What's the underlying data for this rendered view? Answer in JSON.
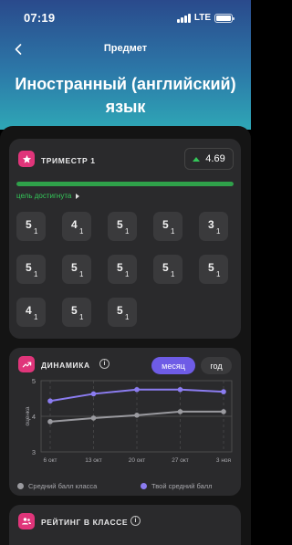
{
  "status_bar": {
    "time": "07:19",
    "network": "LTE"
  },
  "nav": {
    "title": "Предмет"
  },
  "subject": {
    "name": "Иностранный (английский) язык"
  },
  "term": {
    "title": "ТРИМЕСТР 1",
    "average": "4.69",
    "goal_text": "цель достигнута",
    "progress": 1.0,
    "grades": [
      {
        "value": "5",
        "weight": "1"
      },
      {
        "value": "4",
        "weight": "1"
      },
      {
        "value": "5",
        "weight": "1"
      },
      {
        "value": "5",
        "weight": "1"
      },
      {
        "value": "3",
        "weight": "1"
      },
      {
        "value": "5",
        "weight": "1"
      },
      {
        "value": "5",
        "weight": "1"
      },
      {
        "value": "5",
        "weight": "1"
      },
      {
        "value": "5",
        "weight": "1"
      },
      {
        "value": "5",
        "weight": "1"
      },
      {
        "value": "4",
        "weight": "1"
      },
      {
        "value": "5",
        "weight": "1"
      },
      {
        "value": "5",
        "weight": "1"
      }
    ]
  },
  "dynamics": {
    "title": "ДИНАМИКА",
    "info_glyph": "i",
    "period_month": "месяц",
    "period_year": "год",
    "colors": {
      "class": "#9a9a9f",
      "mine": "#8b7cf0"
    }
  },
  "chart_data": {
    "type": "line",
    "x": [
      "6 окт",
      "13 окт",
      "20 окт",
      "27 окт",
      "3 ноя"
    ],
    "ylabel": "оценка",
    "ylim": [
      3,
      5
    ],
    "yticks": [
      "5",
      "4",
      "3"
    ],
    "series": [
      {
        "name": "Средний балл класса",
        "values": [
          3.85,
          3.95,
          4.03,
          4.13,
          4.13
        ]
      },
      {
        "name": "Твой средний балл",
        "values": [
          4.43,
          4.63,
          4.75,
          4.75,
          4.69
        ]
      }
    ]
  },
  "rating": {
    "title": "РЕЙТИНГ В КЛАССЕ",
    "info_glyph": "i"
  }
}
